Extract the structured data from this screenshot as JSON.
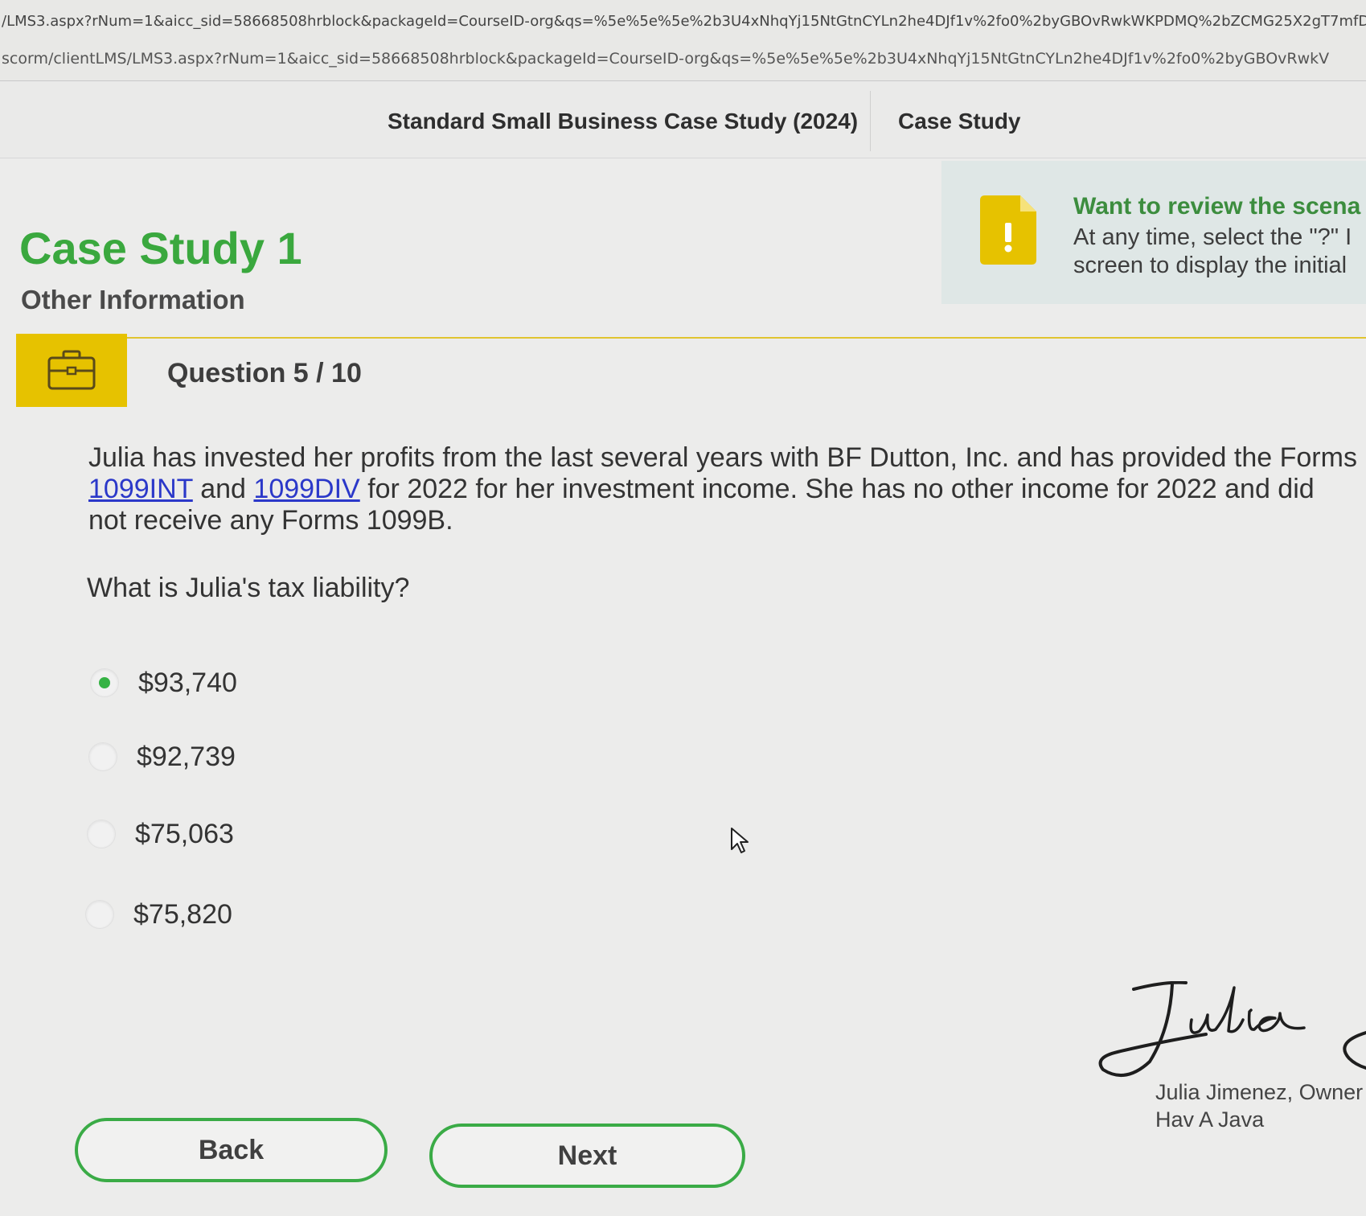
{
  "browser": {
    "url_line_1": "/LMS3.aspx?rNum=1&aicc_sid=58668508hrblock&packageId=CourseID-org&qs=%5e%5e%5e%2b3U4xNhqYj15NtGtnCYLn2he4DJf1v%2fo0%2byGBOvRwkWKPDMQ%2bZCMG25X2gT7mfDx1ppVNLICPY",
    "url_line_2": "scorm/clientLMS/LMS3.aspx?rNum=1&aicc_sid=58668508hrblock&packageId=CourseID-org&qs=%5e%5e%5e%2b3U4xNhqYj15NtGtnCYLn2he4DJf1v%2fo0%2byGBOvRwkV"
  },
  "top_nav": {
    "course_title": "Standard Small Business Case Study (2024)",
    "section_title": "Case Study"
  },
  "header": {
    "title": "Case Study 1",
    "subtitle": "Other Information"
  },
  "review_panel": {
    "icon": "document-alert-icon",
    "heading": "Want to review the scena",
    "line_1": "At any time, select the \"?\" I",
    "line_2": "screen to display the initial"
  },
  "question": {
    "icon": "briefcase-icon",
    "label": "Question 5 / 10",
    "text_1": "Julia has invested her profits from the last several years with BF Dutton, Inc. and has provided the Forms ",
    "link_1": "1099INT",
    "text_2": " and ",
    "link_2": "1099DIV",
    "text_3": " for 2022 for her investment income. She has no other income for 2022 and did not receive any Forms 1099B.",
    "prompt": "What is Julia's tax liability?",
    "options": [
      {
        "label": "$93,740",
        "selected": true
      },
      {
        "label": "$92,739",
        "selected": false
      },
      {
        "label": "$75,063",
        "selected": false
      },
      {
        "label": "$75,820",
        "selected": false
      }
    ]
  },
  "signature": {
    "script": "Julia",
    "name": "Julia Jimenez, Owner",
    "company": "Hav A Java"
  },
  "buttons": {
    "back": "Back",
    "next": "Next"
  },
  "colors": {
    "accent_green": "#3aa83e",
    "band_yellow": "#e6c200",
    "link_blue": "#2b38c9",
    "radio_selected": "#35b244"
  }
}
